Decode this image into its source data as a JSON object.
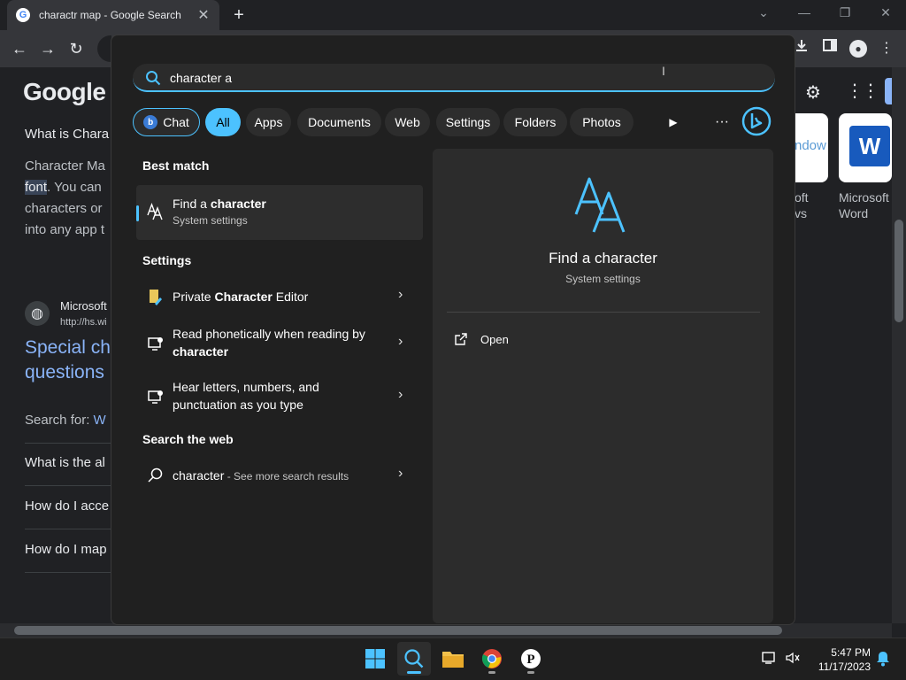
{
  "browser": {
    "tab_title": "charactr map - Google Search",
    "favicon": "G",
    "tab_close": "✕",
    "new_tab": "+"
  },
  "google_page": {
    "logo": "Google",
    "question1": "What is Chara",
    "answer_lines": [
      "Character Ma",
      "font",
      ". You can",
      "characters or",
      "into any app t"
    ],
    "source_name": "Microsoft",
    "source_url": "http://hs.wi",
    "result_title_lines": [
      "Special ch",
      "questions"
    ],
    "search_for_prefix": "Search for: ",
    "search_for_link": "W",
    "faq": [
      "What is the al",
      "How do I acce",
      "How do I map"
    ],
    "cards": [
      {
        "label_lines": [
          "oft",
          "vs"
        ],
        "tile_text": "ndow"
      },
      {
        "label_lines": [
          "Microsoft",
          "Word"
        ],
        "tile_text": "W"
      }
    ]
  },
  "search": {
    "query": "character a",
    "filters": {
      "chat": "Chat",
      "all": "All",
      "apps": "Apps",
      "documents": "Documents",
      "web": "Web",
      "settings": "Settings",
      "folders": "Folders",
      "photos": "Photos"
    },
    "play_glyph": "▶",
    "more_glyph": "···",
    "best_match_heading": "Best match",
    "best_match": {
      "title": "Find a character",
      "title_plain": "Find a ",
      "title_bold": "character",
      "subtitle": "System settings"
    },
    "settings_heading": "Settings",
    "settings_items": [
      {
        "pre": "Private ",
        "bold": "Character",
        "post": " Editor"
      },
      {
        "line1": "Read phonetically when reading by",
        "line2_bold": "character"
      },
      {
        "line1": "Hear letters, numbers, and",
        "line2": "punctuation as you type"
      }
    ],
    "web_heading": "Search the web",
    "web_item": {
      "query": "character",
      "suffix": " - See more search results"
    },
    "chevron": "›",
    "preview": {
      "title": "Find a character",
      "subtitle": "System settings",
      "open_label": "Open"
    }
  },
  "taskbar": {
    "time": "5:47 PM",
    "date": "11/17/2023",
    "apps": [
      "start",
      "search",
      "file-explorer",
      "chrome",
      "p-app"
    ]
  },
  "colors": {
    "accent": "#4cc2ff",
    "panel": "#202020",
    "link": "#8ab4f8"
  }
}
